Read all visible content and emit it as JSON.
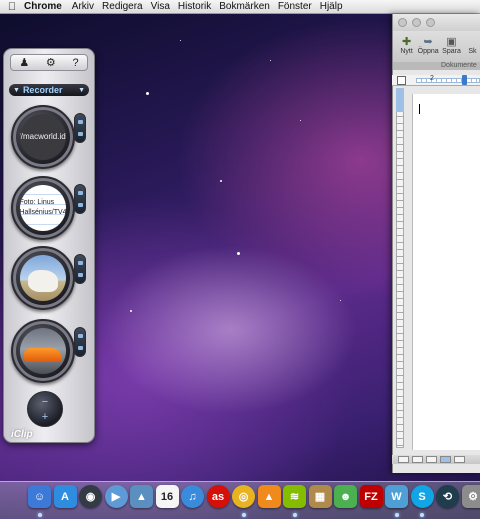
{
  "menubar": {
    "apple_icon": "apple-icon",
    "items": [
      "Chrome",
      "Arkiv",
      "Redigera",
      "Visa",
      "Historik",
      "Bokmärken",
      "Fönster",
      "Hjälp"
    ]
  },
  "iclip": {
    "toolbar": {
      "icons": [
        "person-icon",
        "gear-icon",
        "help-icon"
      ],
      "help_label": "?"
    },
    "recorder_label": "Recorder",
    "clips": [
      {
        "type": "text",
        "text": "http://macworld.idg.se/"
      },
      {
        "type": "text",
        "text": "Foto: Linus Hallsénius/TV4"
      },
      {
        "type": "image",
        "subject": "horse-image"
      },
      {
        "type": "image",
        "subject": "car-image"
      }
    ],
    "add_button": {
      "minus": "−",
      "plus": "+"
    },
    "brand_label": "iClip"
  },
  "word": {
    "toolbar": [
      {
        "icon": "new-document-icon",
        "label": "Nytt"
      },
      {
        "icon": "open-icon",
        "label": "Öppna"
      },
      {
        "icon": "save-icon",
        "label": "Spara"
      },
      {
        "icon": "more-icon",
        "label": "Sk"
      }
    ],
    "gallery_label": "Dokumente",
    "ruler_number": "2"
  },
  "dock": {
    "items": [
      {
        "name": "finder-icon",
        "color": "#3d7ad8",
        "glyph": "☺",
        "running": true
      },
      {
        "name": "app-store-icon",
        "color": "#2f8de0",
        "glyph": "A",
        "running": false
      },
      {
        "name": "dashboard-icon",
        "color": "#333b44",
        "glyph": "◉",
        "running": false
      },
      {
        "name": "facetime-icon",
        "color": "#5d9ad6",
        "glyph": "▶",
        "running": false
      },
      {
        "name": "preview-icon",
        "color": "#5a8fc0",
        "glyph": "▲",
        "running": false
      },
      {
        "name": "calendar-icon",
        "color": "#f5f5f5",
        "glyph": "16",
        "running": false
      },
      {
        "name": "itunes-icon",
        "color": "#3a8bdc",
        "glyph": "♫",
        "running": false
      },
      {
        "name": "lastfm-icon",
        "color": "#d51007",
        "glyph": "as",
        "running": false
      },
      {
        "name": "chrome-icon",
        "color": "#e8b323",
        "glyph": "◎",
        "running": true
      },
      {
        "name": "vlc-icon",
        "color": "#f08a1c",
        "glyph": "▲",
        "running": false
      },
      {
        "name": "spotify-icon",
        "color": "#84bd00",
        "glyph": "≋",
        "running": true
      },
      {
        "name": "photos-icon",
        "color": "#b08a4a",
        "glyph": "▦",
        "running": false
      },
      {
        "name": "adium-icon",
        "color": "#4caf50",
        "glyph": "☻",
        "running": false
      },
      {
        "name": "filezilla-icon",
        "color": "#bf0000",
        "glyph": "FZ",
        "running": false
      },
      {
        "name": "wunderlist-icon",
        "color": "#4e9fd6",
        "glyph": "W",
        "running": true
      },
      {
        "name": "skype-icon",
        "color": "#12a5e6",
        "glyph": "S",
        "running": true
      },
      {
        "name": "time-machine-icon",
        "color": "#1f3d4d",
        "glyph": "⟲",
        "running": false
      },
      {
        "name": "system-preferences-icon",
        "color": "#8c8c8c",
        "glyph": "⚙",
        "running": false
      }
    ]
  }
}
